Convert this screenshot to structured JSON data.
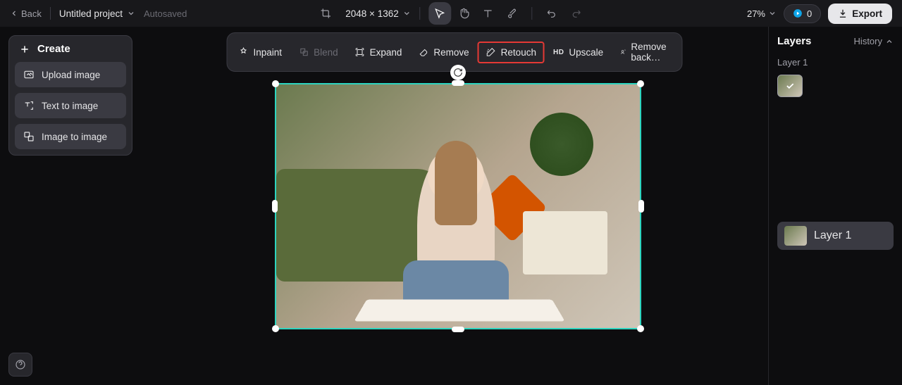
{
  "topbar": {
    "back_label": "Back",
    "project_name": "Untitled project",
    "autosaved": "Autosaved",
    "dimensions": "2048 × 1362",
    "zoom": "27%",
    "credits": "0",
    "export_label": "Export"
  },
  "left": {
    "create_label": "Create",
    "upload_label": "Upload image",
    "text_to_image_label": "Text to image",
    "image_to_image_label": "Image to image"
  },
  "context": {
    "inpaint": "Inpaint",
    "blend": "Blend",
    "expand": "Expand",
    "remove": "Remove",
    "retouch": "Retouch",
    "upscale": "Upscale",
    "remove_bg": "Remove back…"
  },
  "right": {
    "layers_title": "Layers",
    "history_label": "History",
    "layer1_label": "Layer 1",
    "layer_row_label": "Layer 1"
  }
}
